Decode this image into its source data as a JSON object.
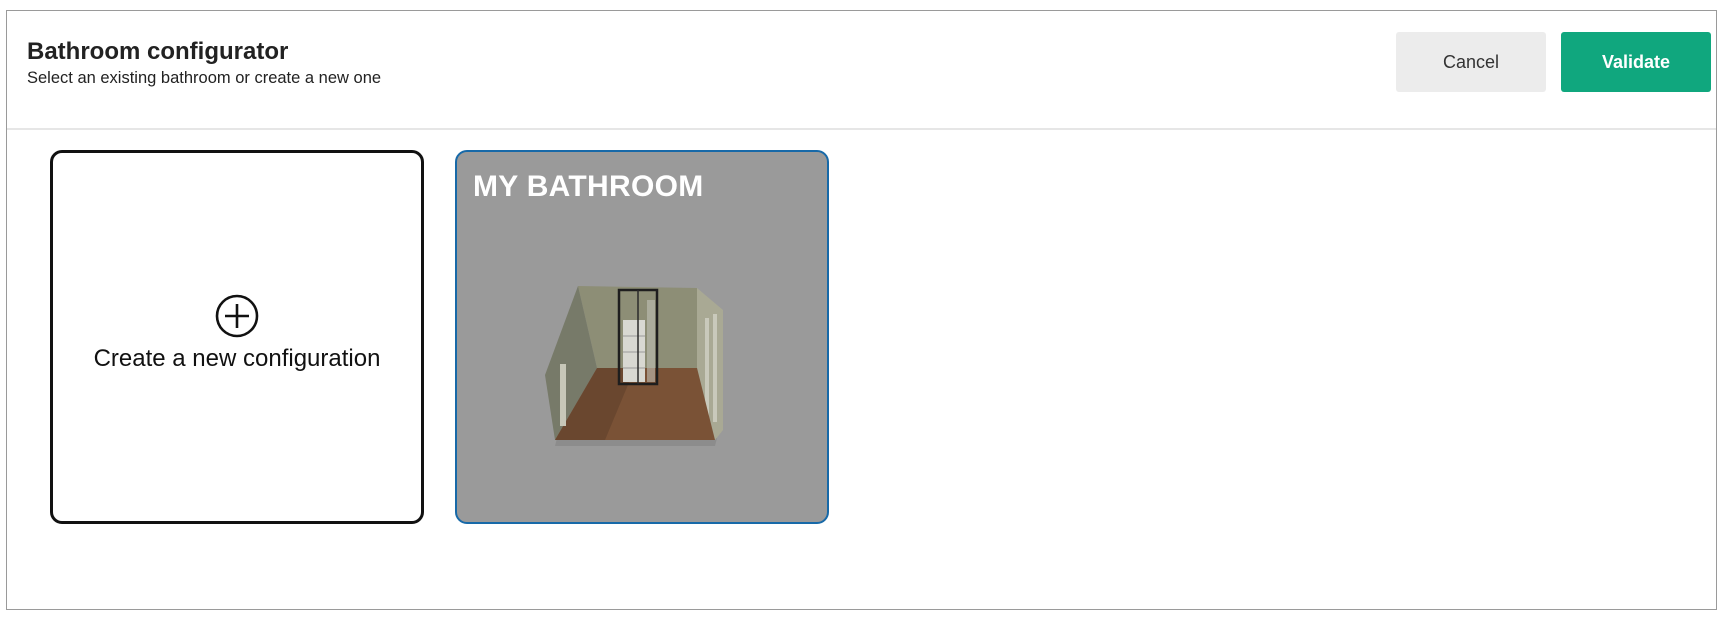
{
  "header": {
    "title": "Bathroom configurator",
    "subtitle": "Select an existing bathroom or create a new one"
  },
  "actions": {
    "cancel_label": "Cancel",
    "validate_label": "Validate"
  },
  "configurations": {
    "new_label": "Create a new configuration",
    "items": [
      {
        "name": "MY BATHROOM",
        "selected": true
      }
    ]
  },
  "colors": {
    "accent": "#10a77e",
    "selected_border": "#1769a8",
    "card_overlay": "#9a9a9a"
  },
  "icons": {
    "create": "plus-circle-icon",
    "thumbnail": "bathroom-3d-preview"
  }
}
